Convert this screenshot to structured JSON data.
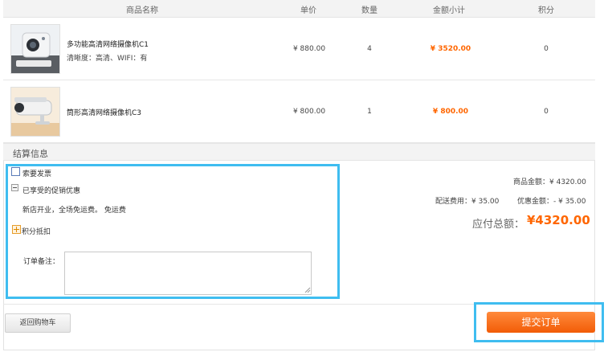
{
  "table_header": {
    "product_name": "商品名称",
    "unit_price": "单价",
    "quantity": "数量",
    "subtotal": "金额小计",
    "points": "积分"
  },
  "items": [
    {
      "name": "多功能高清网络摄像机C1",
      "spec": "清晰度：高清、WIFI：有",
      "price": "¥ 880.00",
      "qty": "4",
      "subtotal": "¥ 3520.00",
      "points": "0",
      "image_icon": "camera-product-image"
    },
    {
      "name": "筒形高清网络摄像机C3",
      "spec": "",
      "price": "¥ 800.00",
      "qty": "1",
      "subtotal": "¥ 800.00",
      "points": "0",
      "image_icon": "bullet-camera-product-image"
    }
  ],
  "settlement": {
    "title": "结算信息",
    "invoice_label": "索要发票",
    "promo_label": "已享受的促销优惠",
    "promo_text": "新店开业，全场免运费。 免运费",
    "points_deduct_label": "积分抵扣",
    "remark_label": "订单备注："
  },
  "summary": {
    "goods_amount": "商品金额：¥ 4320.00",
    "shipping": "配送费用：¥ 35.00",
    "discount": "优惠金额：- ¥ 35.00",
    "total_label": "应付总额：",
    "total_value": "¥4320.00"
  },
  "buttons": {
    "back": "返回购物车",
    "submit": "提交订单"
  },
  "colors": {
    "accent": "#ff6600",
    "highlight_border": "#3fbdf0"
  }
}
